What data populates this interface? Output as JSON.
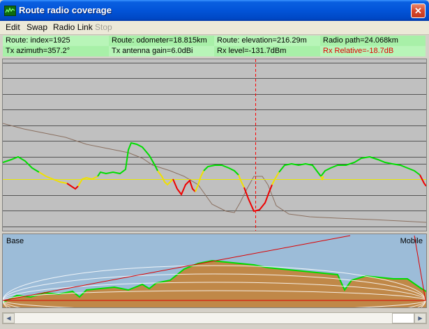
{
  "window": {
    "title": "Route radio coverage"
  },
  "menu": [
    {
      "label": "Edit",
      "enabled": true
    },
    {
      "label": "Swap",
      "enabled": true
    },
    {
      "label": "Radio Link",
      "enabled": true
    },
    {
      "label": "Stop",
      "enabled": false
    }
  ],
  "status": {
    "row1": [
      "Route: index=1925",
      "Route: odometer=18.815km",
      "Route: elevation=216.29m",
      "Radio path=24.068km"
    ],
    "row2": [
      "Tx azimuth=357.2°",
      "Tx antenna gain=6.0dBi",
      "Rx level=-131.7dBm",
      "Rx Relative=-18.7dB"
    ]
  },
  "profile": {
    "base_label": "Base",
    "mobile_label": "Mobile"
  },
  "scrollbar": {
    "position": 0.92
  },
  "colors": {
    "good": "#00dd00",
    "marginal": "#f0e000",
    "bad": "#ee0000",
    "threshold": "#e8e800",
    "terrain": "#c08848",
    "cursor": "#ff0000"
  },
  "icons": {
    "app": "radio-app-icon",
    "close": "close-icon",
    "left": "arrow-left-icon",
    "right": "arrow-right-icon"
  }
}
